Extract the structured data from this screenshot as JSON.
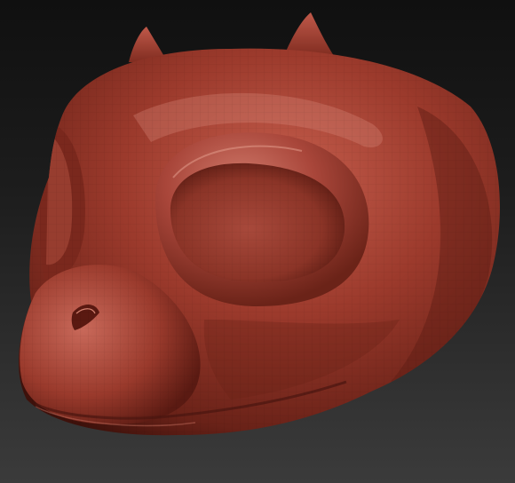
{
  "viewport": {
    "background_top": "#101010",
    "background_bottom": "#3b3b3b"
  },
  "model": {
    "subject": "sculpted-creature-head",
    "material_color": "#9c3a2c",
    "shadow_color": "#4a150f",
    "highlight_color": "#d98272",
    "wireframe_visible": true,
    "features": [
      "left-horn",
      "right-horn",
      "eye-socket",
      "left-eye-socket",
      "nostril",
      "mouth-line"
    ]
  }
}
